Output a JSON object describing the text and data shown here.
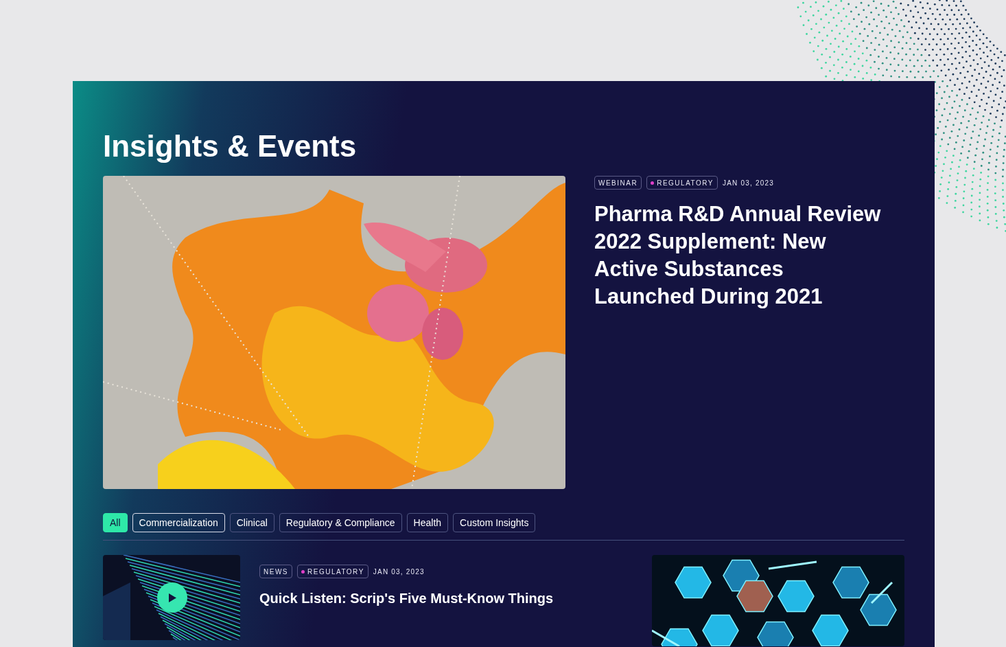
{
  "section": {
    "title": "Insights & Events"
  },
  "featured": {
    "tags": [
      {
        "label": "WEBINAR",
        "kind": "plain"
      },
      {
        "label": "REGULATORY",
        "kind": "dot",
        "color": "#e040c8"
      }
    ],
    "date": "JAN 03, 2023",
    "title": "Pharma R&D Annual Review 2022 Supplement: New Active Substances Launched During 2021"
  },
  "filters": [
    {
      "label": "All",
      "selected": true,
      "highlighted": false
    },
    {
      "label": "Commercialization",
      "selected": false,
      "highlighted": true
    },
    {
      "label": "Clinical",
      "selected": false,
      "highlighted": false
    },
    {
      "label": "Regulatory & Compliance",
      "selected": false,
      "highlighted": false
    },
    {
      "label": "Health",
      "selected": false,
      "highlighted": false
    },
    {
      "label": "Custom Insights",
      "selected": false,
      "highlighted": false
    }
  ],
  "article": {
    "tags": [
      {
        "label": "NEWS",
        "kind": "plain"
      },
      {
        "label": "REGULATORY",
        "kind": "dot",
        "color": "#e040c8"
      }
    ],
    "date": "JAN 03, 2023",
    "title": "Quick Listen: Scrip's Five Must-Know Things",
    "playable": true
  }
}
